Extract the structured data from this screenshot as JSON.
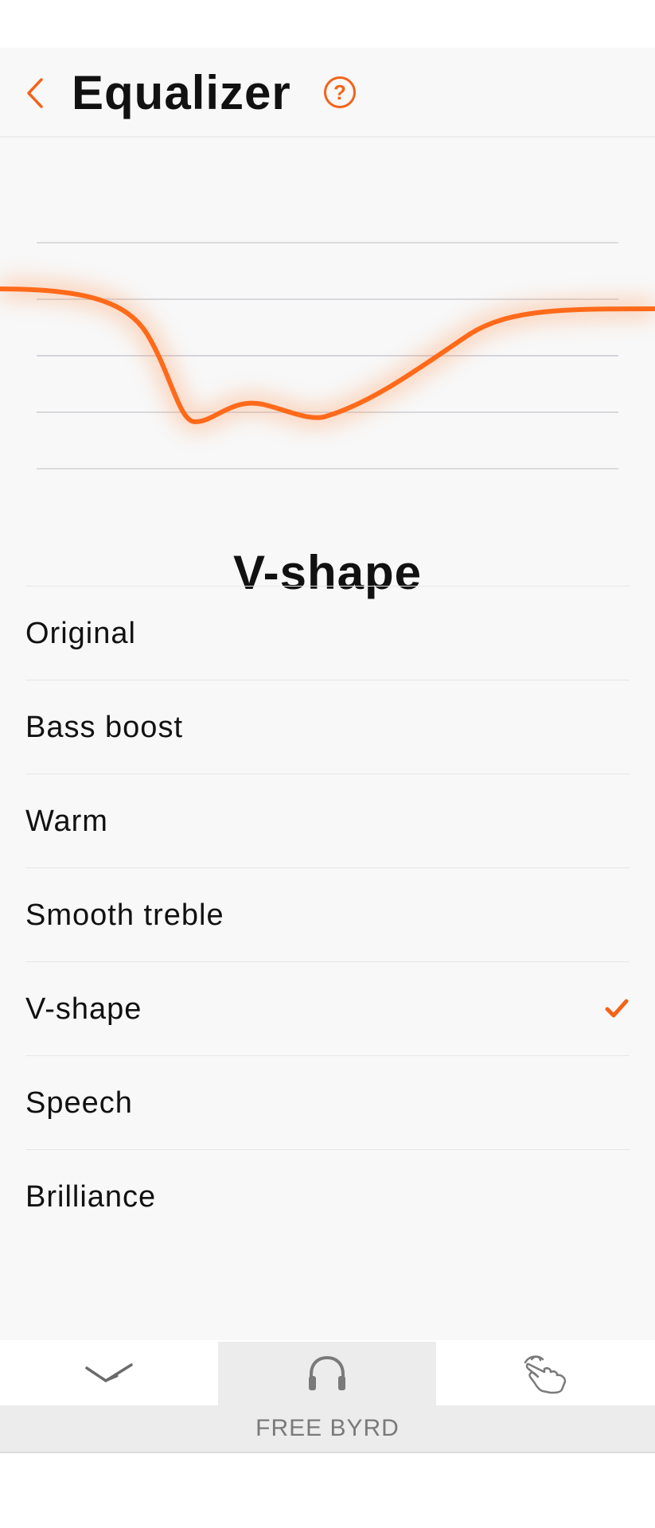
{
  "header": {
    "title": "Equalizer",
    "help_label": "?"
  },
  "equalizer": {
    "selected_preset": "V-shape",
    "curve_color": "#ff6a1a"
  },
  "presets": [
    {
      "label": "Original",
      "selected": false
    },
    {
      "label": "Bass boost",
      "selected": false
    },
    {
      "label": "Warm",
      "selected": false
    },
    {
      "label": "Smooth treble",
      "selected": false
    },
    {
      "label": "V-shape",
      "selected": true
    },
    {
      "label": "Speech",
      "selected": false
    },
    {
      "label": "Brilliance",
      "selected": false
    }
  ],
  "bottom_nav": {
    "tabs": [
      {
        "icon": "bird-logo-icon",
        "active": false
      },
      {
        "icon": "headphones-icon",
        "active": true
      },
      {
        "icon": "touch-gesture-icon",
        "active": false
      }
    ]
  },
  "device": {
    "name": "FREE BYRD"
  },
  "colors": {
    "accent": "#f26419",
    "background": "#f8f8f8",
    "divider": "#e6e6e6"
  }
}
